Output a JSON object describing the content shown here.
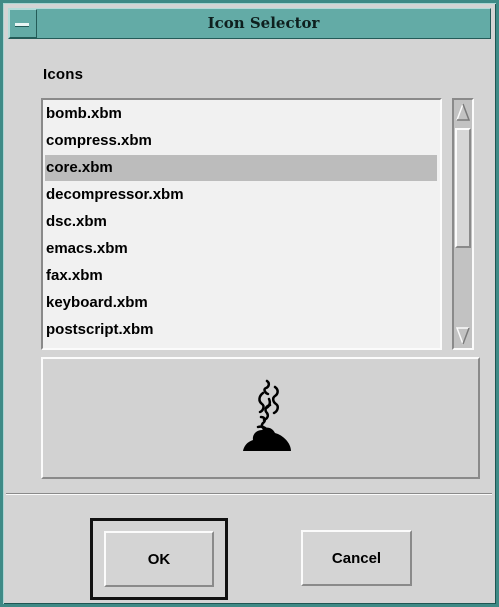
{
  "window": {
    "title": "Icon Selector",
    "menu_icon": "window-menu-icon"
  },
  "list": {
    "label": "Icons",
    "items": [
      "bomb.xbm",
      "compress.xbm",
      "core.xbm",
      "decompressor.xbm",
      "dsc.xbm",
      "emacs.xbm",
      "fax.xbm",
      "keyboard.xbm",
      "postscript.xbm"
    ],
    "selected_item": "core.xbm"
  },
  "preview": {
    "icon": "core-dump-icon"
  },
  "buttons": {
    "ok_label": "OK",
    "cancel_label": "Cancel"
  },
  "colors": {
    "title_bar": "#63aba6",
    "window_frame": "#3e8a86",
    "dialog_background": "#d4d4d4",
    "list_background": "#f1f1f1",
    "selection": "#bcbcbc"
  }
}
